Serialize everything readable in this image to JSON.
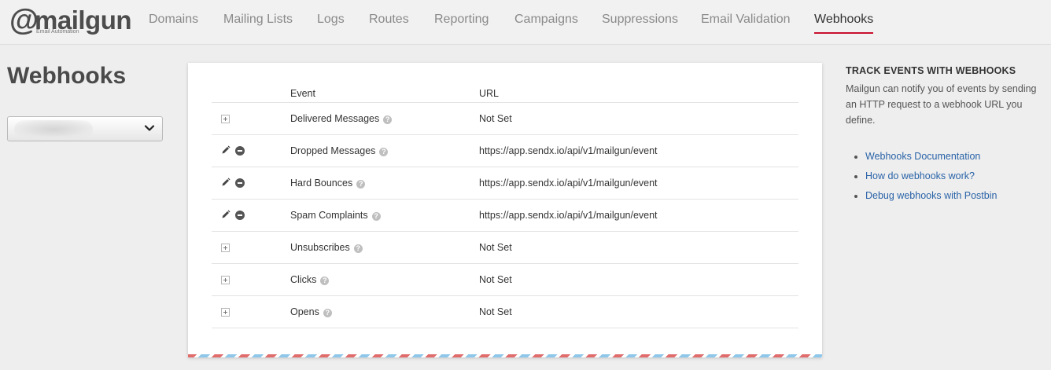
{
  "brand": {
    "logo_mark": "@",
    "logo_word": "mailgun",
    "logo_tagline": "Email Automation",
    "accent_color": "#c8102e",
    "link_color": "#2a63a8"
  },
  "nav": {
    "items": [
      {
        "label": "Domains"
      },
      {
        "label": "Mailing Lists"
      },
      {
        "label": "Logs"
      },
      {
        "label": "Routes"
      },
      {
        "label": "Reporting"
      },
      {
        "label": "Campaigns"
      },
      {
        "label": "Suppressions"
      },
      {
        "label": "Email Validation"
      },
      {
        "label": "Webhooks",
        "active": true
      }
    ]
  },
  "page": {
    "title": "Webhooks",
    "domain_select": {
      "value": "",
      "icon": "chevron-down-icon"
    }
  },
  "table": {
    "headers": {
      "event": "Event",
      "url": "URL"
    },
    "rows": [
      {
        "event": "Delivered Messages",
        "url": "Not Set",
        "actions": [
          "add"
        ]
      },
      {
        "event": "Dropped Messages",
        "url": "https://app.sendx.io/api/v1/mailgun/event",
        "actions": [
          "edit",
          "remove"
        ]
      },
      {
        "event": "Hard Bounces",
        "url": "https://app.sendx.io/api/v1/mailgun/event",
        "actions": [
          "edit",
          "remove"
        ]
      },
      {
        "event": "Spam Complaints",
        "url": "https://app.sendx.io/api/v1/mailgun/event",
        "actions": [
          "edit",
          "remove"
        ]
      },
      {
        "event": "Unsubscribes",
        "url": "Not Set",
        "actions": [
          "add"
        ]
      },
      {
        "event": "Clicks",
        "url": "Not Set",
        "actions": [
          "add"
        ]
      },
      {
        "event": "Opens",
        "url": "Not Set",
        "actions": [
          "add"
        ]
      }
    ]
  },
  "sidebar": {
    "heading": "TRACK EVENTS WITH WEBHOOKS",
    "description": "Mailgun can notify you of events by sending an HTTP request to a webhook URL you define.",
    "links": [
      {
        "label": "Webhooks Documentation"
      },
      {
        "label": "How do webhooks work?"
      },
      {
        "label": "Debug webhooks with Postbin"
      }
    ]
  }
}
